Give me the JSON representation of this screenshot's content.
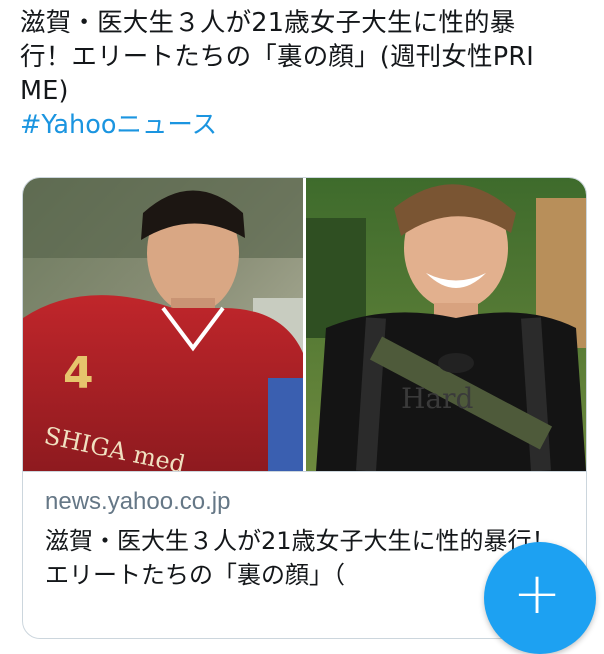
{
  "tweet": {
    "text": "滋賀・医大生３人が21歳女子大生に性的暴行！エリートたちの「裏の顔」(週刊女性PRIME)",
    "hashtag": "#Yahooニュース"
  },
  "card": {
    "images": [
      {
        "alt_icon": "photo-soccer-player-icon"
      },
      {
        "alt_icon": "photo-smiling-man-icon"
      }
    ],
    "domain": "news.yahoo.co.jp",
    "title": "滋賀・医大生３人が21歳女子大生に性的暴行！エリートたちの「裏の顔」（"
  },
  "fab": {
    "label": "+"
  },
  "colors": {
    "accent": "#1da1f2",
    "link": "#1b95e0",
    "border": "#ccd6dd",
    "secondary_text": "#657786"
  }
}
